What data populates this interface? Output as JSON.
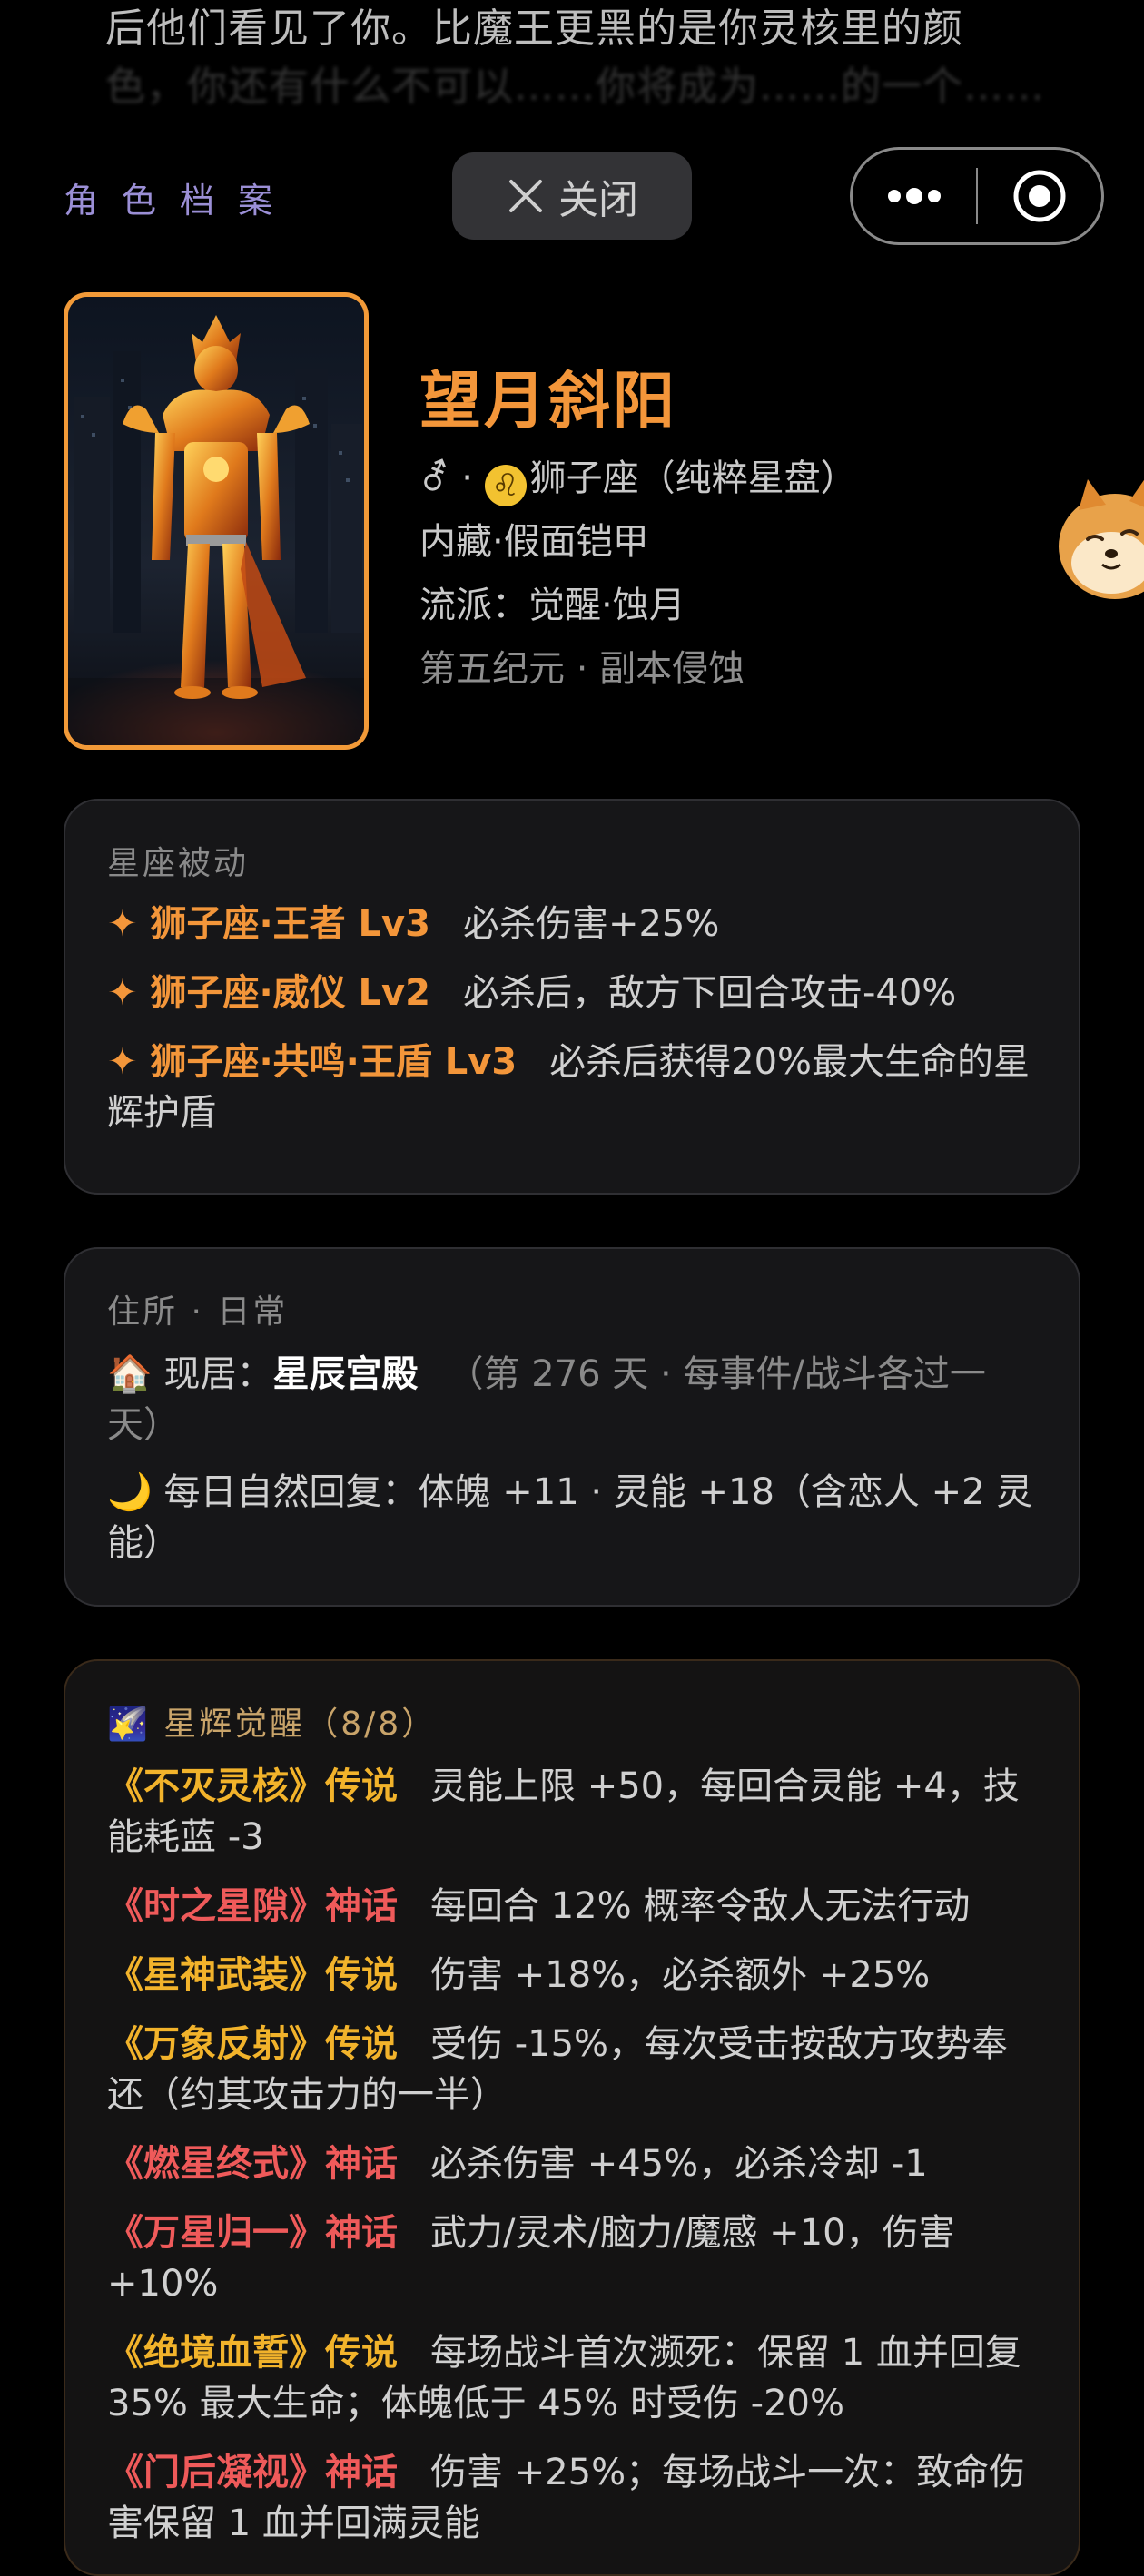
{
  "story": {
    "line1": "后他们看见了你。比魔王更黑的是你灵核里的颜",
    "line2": "色，你还有什么不可以……你将成为……的一个……"
  },
  "header": {
    "section_label": "角色档案",
    "close_label": "关闭"
  },
  "profile": {
    "name": "望月斜阳",
    "gender_symbol": "⚦ · ",
    "zodiac_glyph": "♌",
    "zodiac_text": "狮子座（纯粹星盘）",
    "line2": "内藏·假面铠甲",
    "line3": "流派：觉醒·蚀月",
    "line4": "第五纪元 · 副本侵蚀"
  },
  "passive": {
    "title": "星座被动",
    "items": [
      {
        "tag": "✦ 狮子座·王者 Lv3",
        "desc": "必杀伤害+25%"
      },
      {
        "tag": "✦ 狮子座·威仪 Lv2",
        "desc": "必杀后，敌方下回合攻击-40%"
      },
      {
        "tag": "✦ 狮子座·共鸣·王盾 Lv3",
        "desc": "必杀后获得20%最大生命的星辉护盾"
      }
    ]
  },
  "residence": {
    "title": "住所 · 日常",
    "home_icon": "🏠",
    "home_prefix": " 现居：",
    "home_name": "星辰宫殿",
    "home_note": "（第 276 天 · 每事件/战斗各过一天）",
    "moon_icon": "🌙",
    "recovery": " 每日自然回复：体魄 +11 · 灵能 +18（含恋人 +2 灵能）"
  },
  "awakening": {
    "icon": "🌠",
    "title": " 星辉觉醒（8/8）",
    "items": [
      {
        "tag": "《不灭灵核》传说",
        "rarity": "legend",
        "desc": "灵能上限 +50，每回合灵能 +4，技能耗蓝 -3"
      },
      {
        "tag": "《时之星隙》神话",
        "rarity": "myth",
        "desc": "每回合 12% 概率令敌人无法行动"
      },
      {
        "tag": "《星神武装》传说",
        "rarity": "legend",
        "desc": "伤害 +18%，必杀额外 +25%"
      },
      {
        "tag": "《万象反射》传说",
        "rarity": "legend",
        "desc": "受伤 -15%，每次受击按敌方攻势奉还（约其攻击力的一半）"
      },
      {
        "tag": "《燃星终式》神话",
        "rarity": "myth",
        "desc": "必杀伤害 +45%，必杀冷却 -1"
      },
      {
        "tag": "《万星归一》神话",
        "rarity": "myth",
        "desc": "武力/灵术/脑力/魔感 +10，伤害 +10%"
      },
      {
        "tag": "《绝境血誓》传说",
        "rarity": "legend",
        "desc": "每场战斗首次濒死：保留 1 血并回复 35% 最大生命；体魄低于 45% 时受伤 -20%"
      },
      {
        "tag": "《门后凝视》神话",
        "rarity": "myth",
        "desc": "伤害 +25%；每场战斗一次：致命伤害保留 1 血并回满灵能"
      }
    ]
  },
  "colors": {
    "accent_orange": "#f3963a",
    "legend_yellow": "#f2b32b",
    "myth_red": "#ef5a5a",
    "header_purple": "#9b8fd6"
  }
}
